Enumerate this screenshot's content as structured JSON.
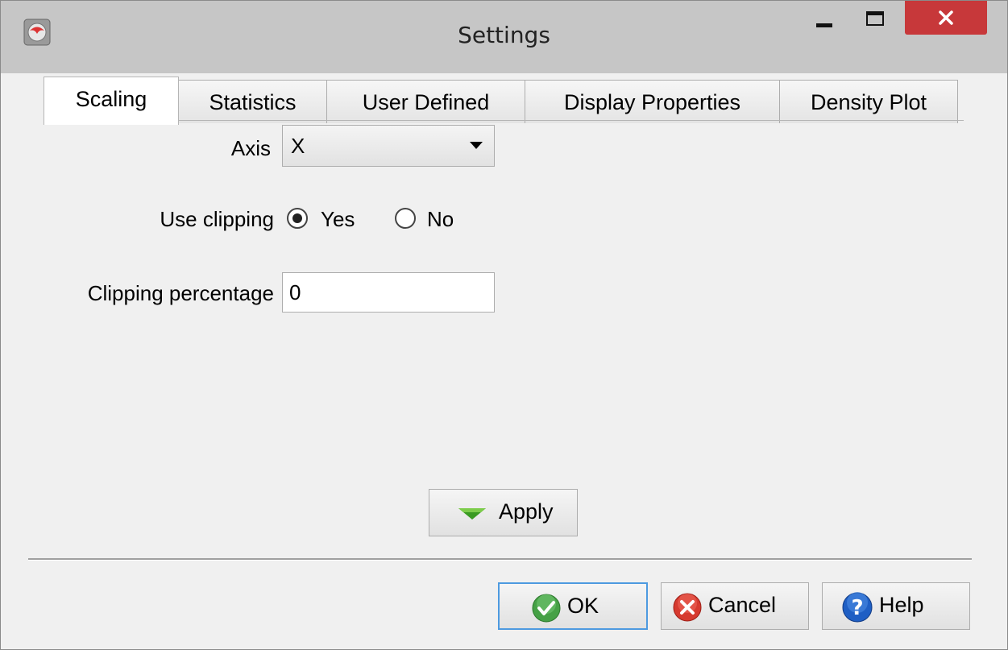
{
  "window": {
    "title": "Settings",
    "colors": {
      "titlebar": "#c6c6c6",
      "close_button": "#c7383a",
      "background": "#f0f0f0"
    }
  },
  "tabs": [
    {
      "label": "Scaling",
      "active": true
    },
    {
      "label": "Statistics",
      "active": false
    },
    {
      "label": "User Defined",
      "active": false
    },
    {
      "label": "Display Properties",
      "active": false
    },
    {
      "label": "Density Plot",
      "active": false
    }
  ],
  "form": {
    "axis_label": "Axis",
    "axis_value": "X",
    "use_clipping_label": "Use clipping",
    "yes_label": "Yes",
    "no_label": "No",
    "use_clipping_selected": "Yes",
    "clipping_percentage_label": "Clipping percentage",
    "clipping_percentage_value": "0"
  },
  "buttons": {
    "apply": "Apply",
    "ok": "OK",
    "cancel": "Cancel",
    "help": "Help"
  },
  "icons": {
    "app": "app-logo-icon",
    "apply": "triangle-down-icon",
    "ok": "checkmark-circle-icon",
    "cancel": "x-circle-icon",
    "help": "question-circle-icon"
  }
}
